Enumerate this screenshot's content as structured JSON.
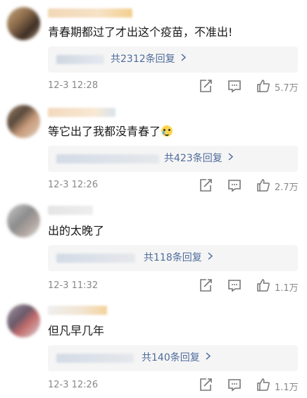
{
  "comments": [
    {
      "text": "青春期都过了才出这个疫苗，不准出!",
      "reply_link": "共2312条回复",
      "time": "12-3 12:28",
      "likes": "5.7万",
      "has_emoji": false
    },
    {
      "text": "等它出了我都没青春了",
      "reply_link": "共423条回复",
      "time": "12-3 12:26",
      "likes": "2.7万",
      "has_emoji": true,
      "emoji": "crying-face-emoji"
    },
    {
      "text": "出的太晚了",
      "reply_link": "共118条回复",
      "time": "12-3 11:32",
      "likes": "1.1万",
      "has_emoji": false
    },
    {
      "text": "但凡早几年",
      "reply_link": "共140条回复",
      "time": "12-3 12:26",
      "likes": "1.1万",
      "has_emoji": false
    }
  ],
  "colors": {
    "link": "#4f6c9c",
    "meta": "#888888",
    "reply_bg": "#f5f5f5"
  },
  "icons": [
    "share-icon",
    "comment-icon",
    "like-icon",
    "chevron-right-icon"
  ]
}
